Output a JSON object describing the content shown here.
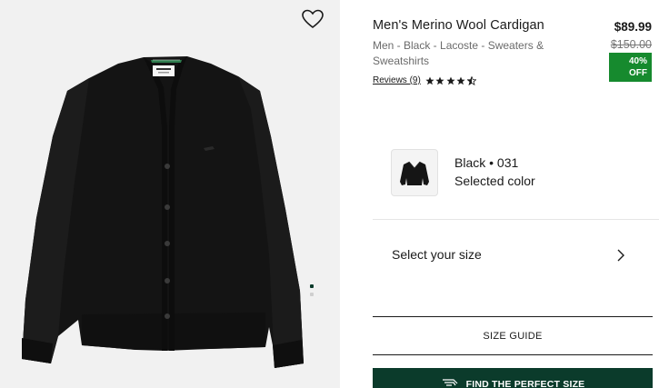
{
  "product": {
    "title": "Men's Merino Wool Cardigan",
    "breadcrumb": "Men - Black - Lacoste - Sweaters & Sweatshirts",
    "reviews_label": "Reviews (9)",
    "rating": 4.5,
    "rating_max": 5
  },
  "pricing": {
    "price": "$89.99",
    "original_price": "$150.00",
    "discount_line1": "40%",
    "discount_line2": "OFF",
    "discount_color": "#168a2e"
  },
  "color": {
    "name": "Black • 031",
    "label": "Selected color"
  },
  "size": {
    "prompt": "Select your size",
    "guide_label": "SIZE GUIDE",
    "fit_button_label": "FIND THE PERFECT SIZE"
  },
  "gallery": {
    "image_index": 1,
    "image_count": 2,
    "wishlist_icon": "heart-outline-icon"
  },
  "theme": {
    "brand_dark_green": "#0b3b2b",
    "gallery_background": "#f1f1f1"
  }
}
